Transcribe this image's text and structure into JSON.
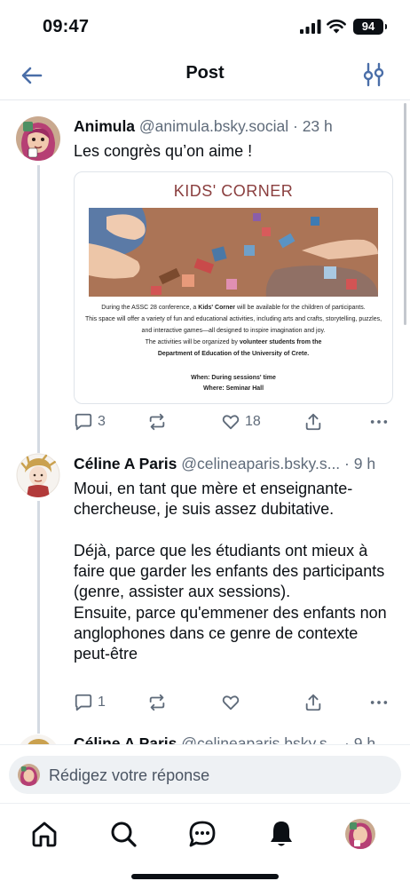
{
  "status_bar": {
    "time": "09:47",
    "battery": "94"
  },
  "header": {
    "title": "Post"
  },
  "posts": [
    {
      "author_name": "Animula",
      "handle": "@animula.bsky.social",
      "time_ago": "· 23 h",
      "text": "Les congrès qu’on aime !",
      "embed": {
        "title": "KIDS' CORNER",
        "line1_pre": "During the ASSC 28 conference, a ",
        "line1_bold": "Kids' Corner",
        "line1_post": " will be available for the children of participants.",
        "line2": "This space will offer a variety of fun and educational activities, including arts and crafts, storytelling, puzzles,",
        "line3": "and interactive games—all designed to inspire imagination and joy.",
        "line4_pre": "The activities will be organized by ",
        "line4_bold": "volunteer students from the",
        "line5_bold": "Department of Education of the University of Crete.",
        "when": "When: During sessions' time",
        "where": "Where: Seminar Hall"
      },
      "replies": "3",
      "reposts": "",
      "likes": "18"
    },
    {
      "author_name": "Céline A Paris",
      "handle": "@celineaparis.bsky.s...",
      "time_ago": "· 9 h",
      "text": "Moui, en tant que mère et enseignante-chercheuse, je suis assez dubitative.\n\nDéjà, parce que les étudiants ont mieux à faire que garder les enfants des participants (genre, assister aux sessions).\nEnsuite, parce qu'emmener des enfants non anglophones dans ce genre de contexte peut-être",
      "replies": "1",
      "reposts": "",
      "likes": ""
    },
    {
      "author_name": "Céline A Paris",
      "handle": "@celineaparis.bsky.s...",
      "time_ago": "· 9 h"
    }
  ],
  "reply_bar": {
    "placeholder": "Rédigez votre réponse"
  },
  "colors": {
    "accent": "#1083fe",
    "thread_line": "#d4dae2",
    "muted": "#5f6b7a",
    "embed_title": "#8a3e3e"
  },
  "tabs": [
    "home-icon",
    "search-icon",
    "chat-icon",
    "notifications-icon",
    "profile-avatar"
  ]
}
